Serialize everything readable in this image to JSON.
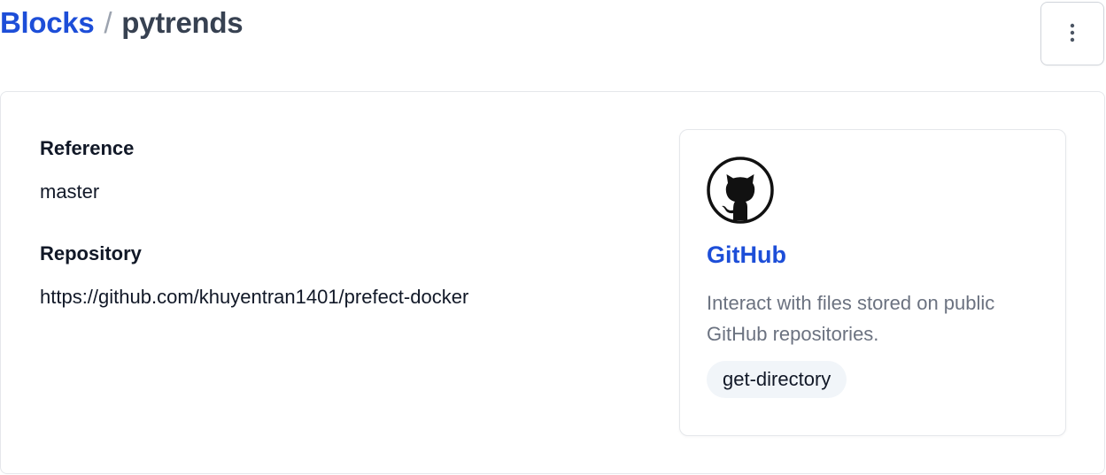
{
  "breadcrumb": {
    "root_label": "Blocks",
    "separator": "/",
    "current_label": "pytrends"
  },
  "actions": {
    "menu_icon": "vertical-ellipsis-icon"
  },
  "block_details": {
    "fields": [
      {
        "label": "Reference",
        "value": "master"
      },
      {
        "label": "Repository",
        "value": "https://github.com/khuyentran1401/prefect-docker"
      }
    ]
  },
  "block_type": {
    "logo_icon": "github-icon",
    "name": "GitHub",
    "description": "Interact with files stored on public GitHub repositories.",
    "capabilities": [
      "get-directory"
    ]
  },
  "colors": {
    "accent": "#1d4ed8",
    "muted_text": "#6b7280",
    "badge_bg": "#f1f5f9",
    "border": "#e5e7eb"
  }
}
